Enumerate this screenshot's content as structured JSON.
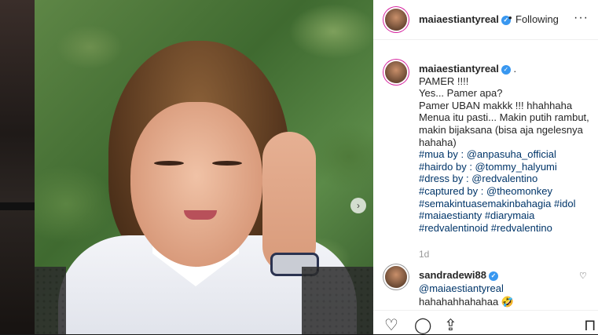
{
  "post": {
    "username": "maiaestiantyreal",
    "verified_glyph": "✓",
    "dot": "•",
    "follow_label": "Following",
    "more_icon": "···",
    "caption_lines": [
      " .",
      "PAMER !!!!",
      "Yes... Pamer apa?",
      "Pamer UBAN makkk !!! hhahhaha",
      "Menua itu pasti... Makin putih rambut,",
      "makin bijaksana (bisa aja ngelesnya",
      "hahaha)"
    ],
    "hashtags": [
      "#mua by : @anpasuha_official",
      "#hairdo by : @tommy_halyumi",
      "#dress by : @redvalentino",
      "#captured by : @theomonkey",
      "#semakintuasemakinbahagia #idol",
      "#maiaestianty #diarymaia",
      "#redvalentinoid #redvalentino"
    ],
    "time_ago": "1d",
    "next_icon": "›"
  },
  "comment": {
    "username": "sandradewi88",
    "verified_glyph": "✓",
    "mention": "@maiaestiantyreal",
    "text": "hahahahhahahaa 🤣",
    "like_icon": "♡"
  },
  "actions": {
    "like_icon": "♡",
    "comment_icon": "◯",
    "share_icon": "⇪",
    "save_icon": "⊓"
  },
  "colors": {
    "link": "#003569",
    "verified": "#3897f0",
    "ring": "#d6249f"
  }
}
